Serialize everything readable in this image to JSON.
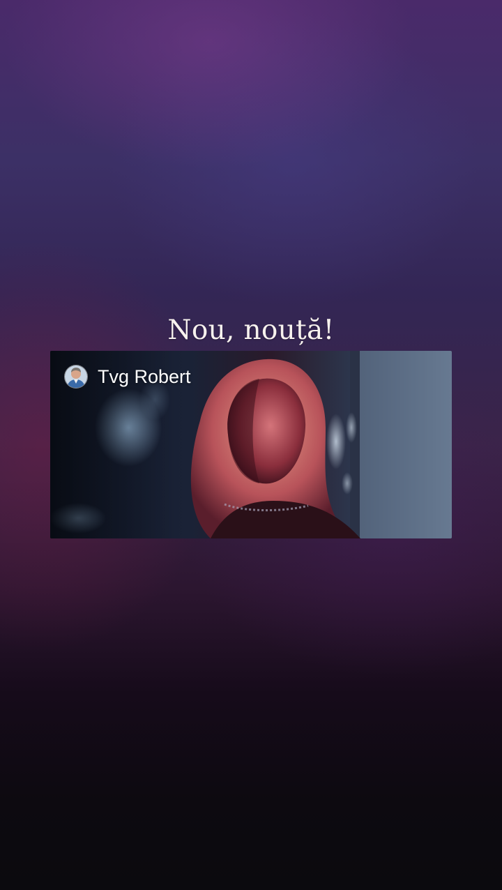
{
  "story": {
    "caption": "Nou, nouță!",
    "shared_post": {
      "author_name": "Tvg Robert",
      "avatar_icon": "profile-photo",
      "media_icon": "video-thumbnail"
    }
  },
  "colors": {
    "caption_text": "#f7f2ee",
    "author_text": "#ffffff",
    "background_top": "#4a2a6a",
    "background_bottom": "#0b0a0e"
  }
}
